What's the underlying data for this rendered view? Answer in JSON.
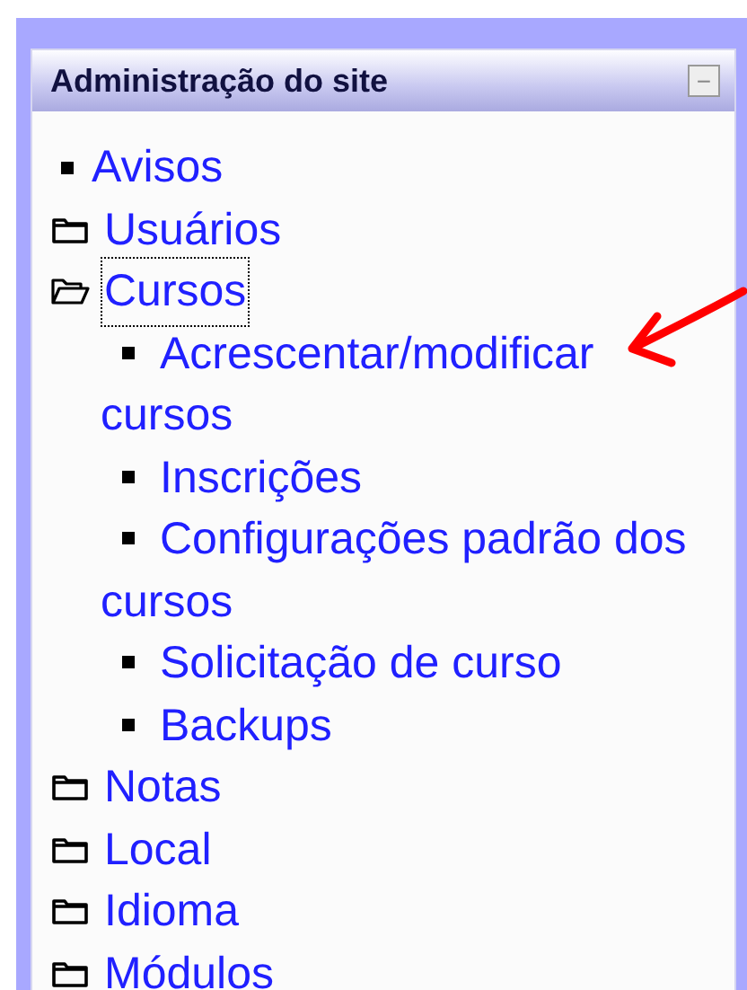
{
  "block": {
    "title": "Administração do site",
    "collapse_symbol": "−"
  },
  "items": [
    {
      "kind": "leaf",
      "label": "Avisos",
      "selected": false
    },
    {
      "kind": "folder",
      "label": "Usuários",
      "expanded": false,
      "selected": false
    },
    {
      "kind": "folder",
      "label": "Cursos",
      "expanded": true,
      "selected": true,
      "children": [
        {
          "kind": "leaf",
          "label": "Acrescentar/modificar cursos"
        },
        {
          "kind": "leaf",
          "label": "Inscrições"
        },
        {
          "kind": "leaf",
          "label": "Configurações padrão dos cursos"
        },
        {
          "kind": "leaf",
          "label": "Solicitação de curso"
        },
        {
          "kind": "leaf",
          "label": "Backups"
        }
      ]
    },
    {
      "kind": "folder",
      "label": "Notas",
      "expanded": false,
      "selected": false
    },
    {
      "kind": "folder",
      "label": "Local",
      "expanded": false,
      "selected": false
    },
    {
      "kind": "folder",
      "label": "Idioma",
      "expanded": false,
      "selected": false
    },
    {
      "kind": "folder",
      "label": "Módulos",
      "expanded": false,
      "selected": false
    }
  ]
}
